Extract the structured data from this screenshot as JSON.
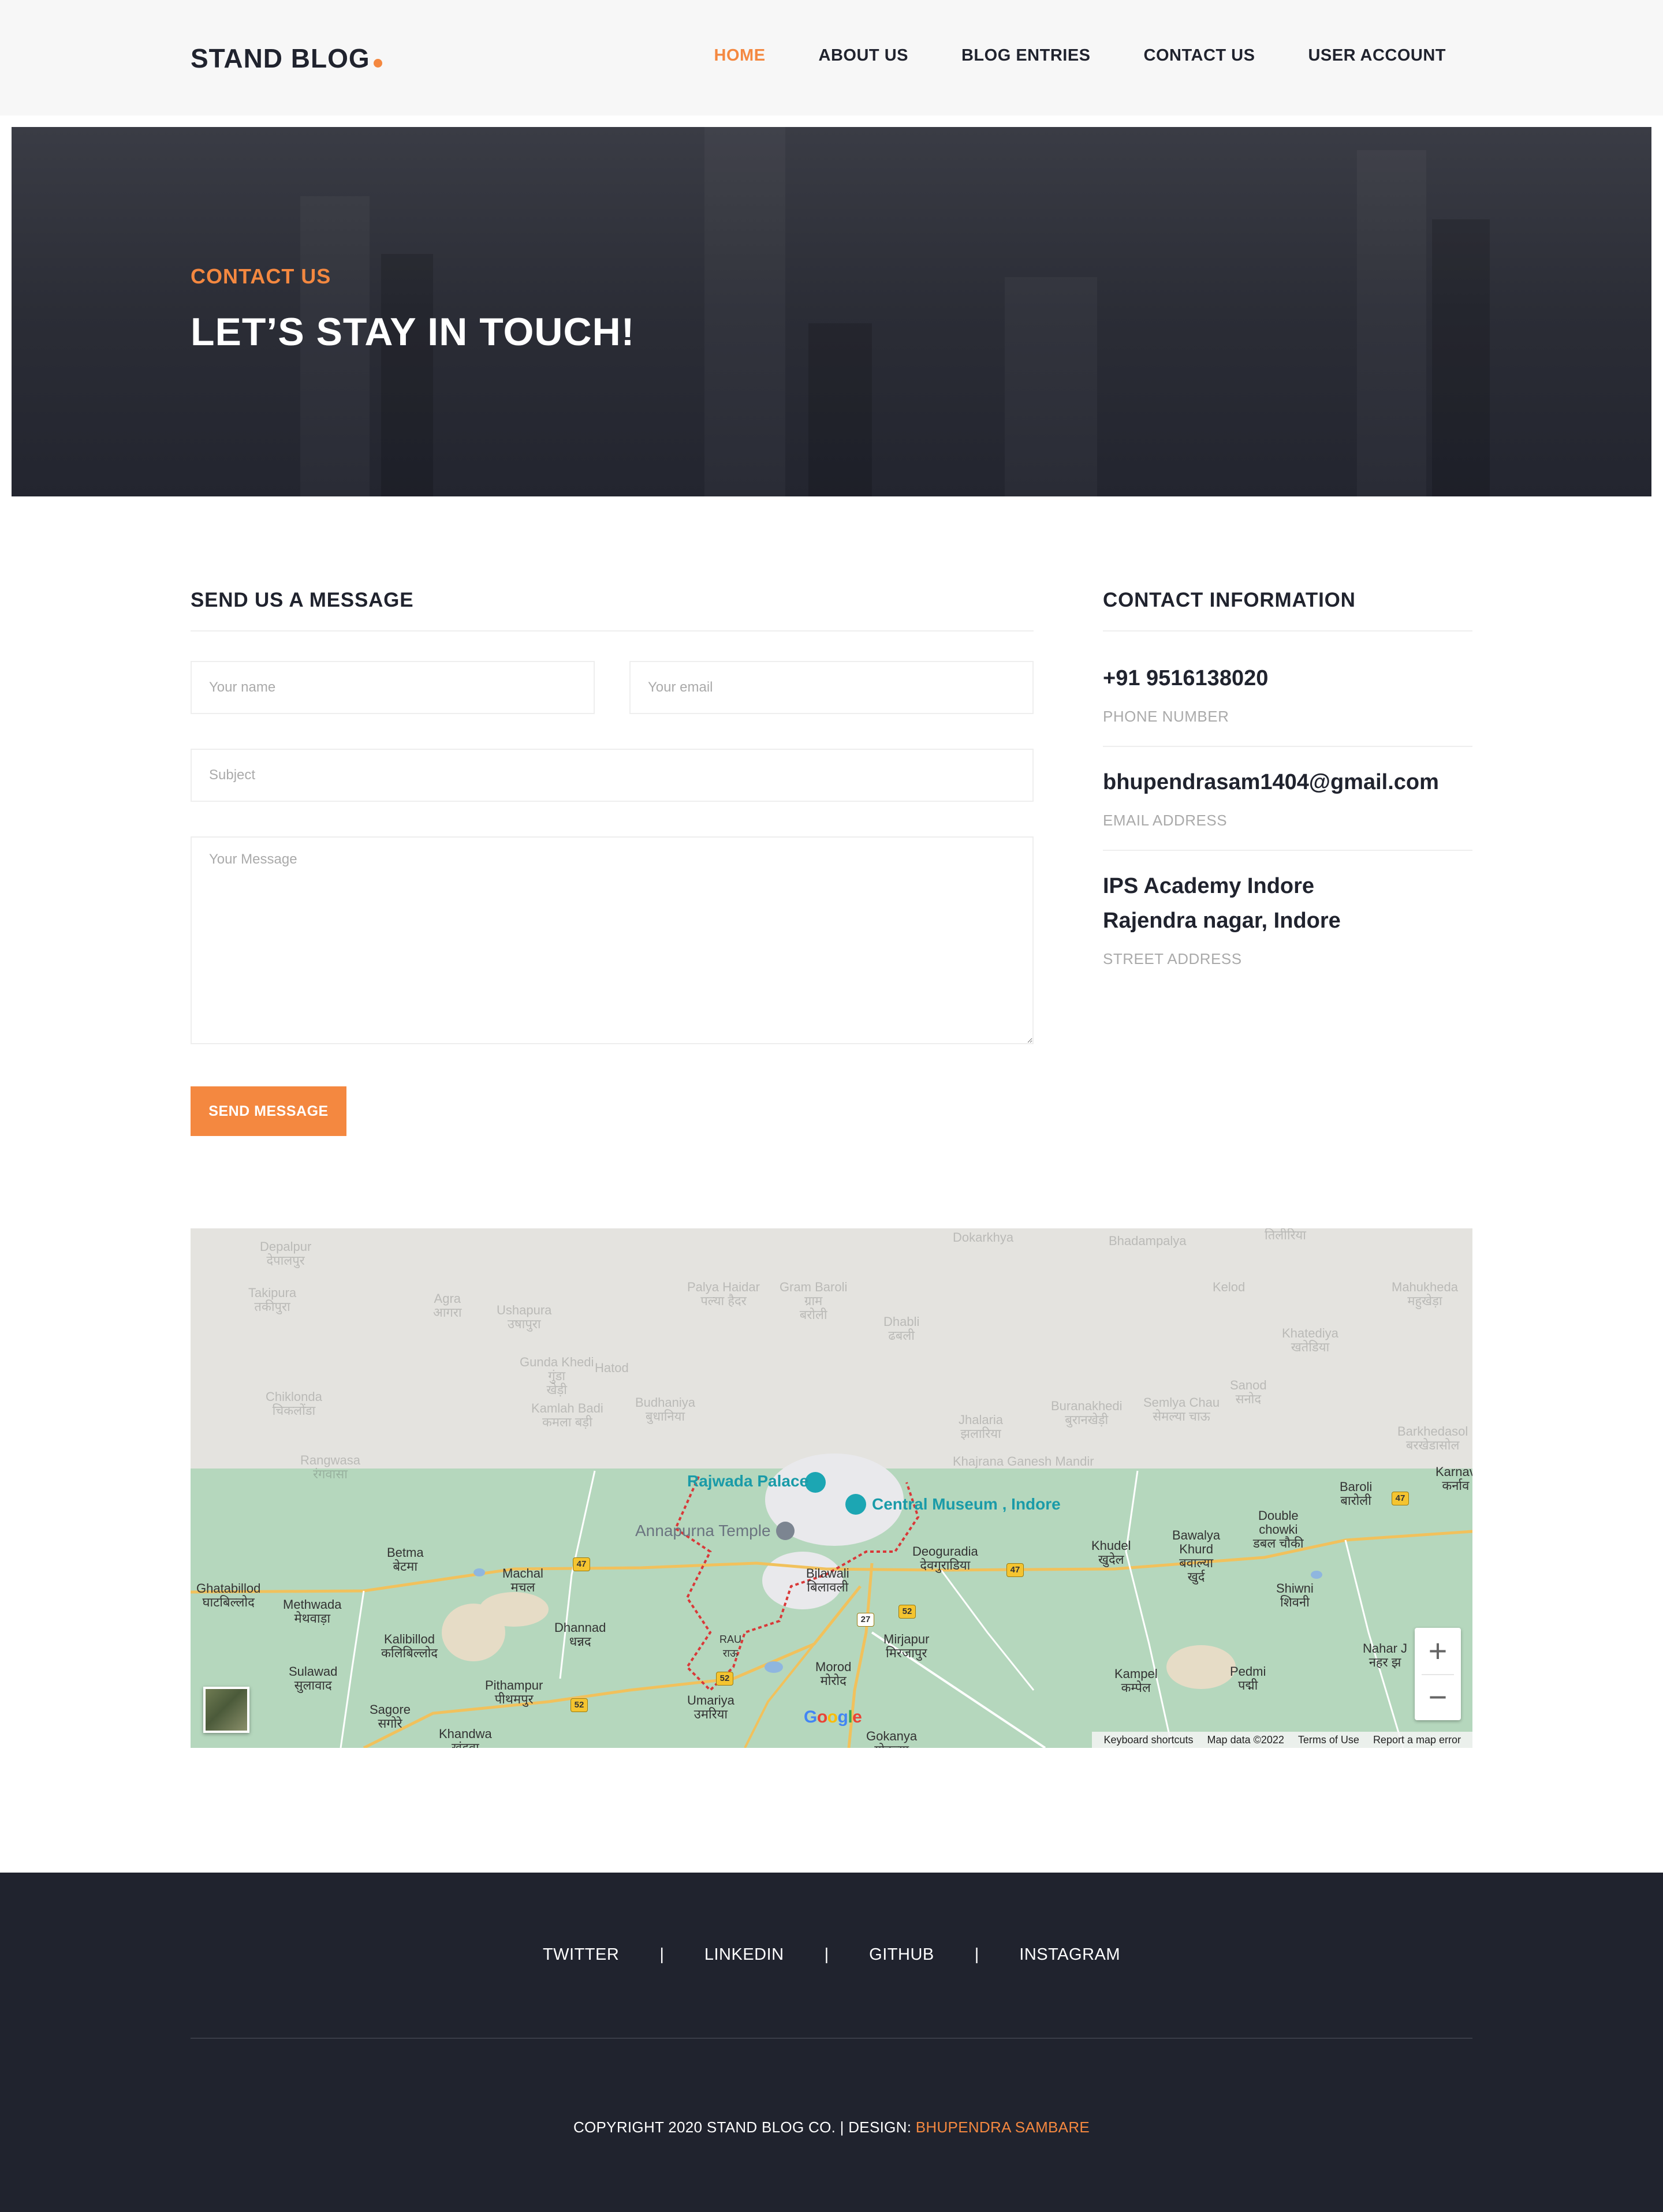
{
  "header": {
    "logo": "STAND BLOG",
    "nav": [
      "HOME",
      "ABOUT US",
      "BLOG ENTRIES",
      "CONTACT US",
      "USER ACCOUNT"
    ],
    "active_index": 0
  },
  "hero": {
    "kicker": "CONTACT US",
    "title": "LET’S STAY IN TOUCH!"
  },
  "form": {
    "title": "SEND US A MESSAGE",
    "name_placeholder": "Your name",
    "email_placeholder": "Your email",
    "subject_placeholder": "Subject",
    "message_placeholder": "Your Message",
    "submit_label": "SEND MESSAGE"
  },
  "contact_info": {
    "title": "CONTACT INFORMATION",
    "phone": "+91 9516138020",
    "phone_label": "PHONE NUMBER",
    "email": "bhupendrasam1404@gmail.com",
    "email_label": "EMAIL ADDRESS",
    "address_line1": "IPS Academy Indore",
    "address_line2": "Rajendra nagar, Indore",
    "address_label": "STREET ADDRESS"
  },
  "map": {
    "poi": {
      "rajwada": "Rajwada Palace",
      "central_museum": "Central Museum , Indore",
      "annapurna": "Annapurna Temple"
    },
    "places": {
      "betma": "Betma\nबेटमा",
      "machal": "Machal\nमचल",
      "ghatabillod": "Ghatabillod\nघाटबिल्लोद",
      "methwada": "Methwada\nमेथवाड़ा",
      "kalibillod": "Kalibillod\nकलिबिल्लोद",
      "dhannad": "Dhannad\nधन्नद",
      "sulawad": "Sulawad\nसुलावाद",
      "sagore": "Sagore\nसगोरे",
      "pithampur": "Pithampur\nपीथमपुर",
      "khandwa": "Khandwa\nखंडवा",
      "umariya": "Umariya\nउमरिया",
      "morod": "Morod\nमोरोद",
      "bilawali": "Bilawali\nबिलावली",
      "mirjapur": "Mirjapur\nमिरजापुर",
      "deoguradia": "Deoguradia\nदेवगुराडिया",
      "gokanya": "Gokanya\nगोकन्या",
      "khudel": "Khudel\nखुदेल",
      "bawalya": "Bawalya\nKhurd\nबवाल्या\nखुर्द",
      "double_chowki": "Double\nchowki\nडबल चौकी",
      "baroli": "Baroli\nबारोली",
      "shiwni": "Shiwni\nशिवनी",
      "kampel": "Kampel\nकम्पेल",
      "pedmi": "Pedmi\nपद्मी",
      "nahar": "Nahar J\nनहर झ",
      "karnav": "Karnav\nकर्नाव",
      "rau": "RAU\nराऊ"
    },
    "faint_places": {
      "depalpur": "Depalpur\nदेपालपुर",
      "takipura": "Takipura\nतकीपुरा",
      "agra": "Agra\nआगरा",
      "ushapura": "Ushapura\nउषापुरा",
      "palya_haidar": "Palya Haidar\nपल्या हैदर",
      "gram_baroli": "Gram Baroli\nग्राम\nबरोली",
      "dokarkhya": "Dokarkhya",
      "bhadampalya": "Bhadampalya",
      "tilirya": "तिलीरिया",
      "mahukheda": "Mahukheda\nमहुखेड़ा",
      "khatediya": "Khatediya\nखतेडिया",
      "kelod": "Kelod",
      "sanod": "Sanod\nसनोद",
      "gunda_khedi": "Gunda Khedi\nगुंडा\nखेड़ी",
      "hatod": "Hatod",
      "chiklonda": "Chiklonda\nचिकलोंडा",
      "kamlah": "Kamlah Badi\nकमला बड़ी",
      "budhaniya": "Budhaniya\nबुधानिया",
      "jhalaria": "Jhalaria\nझलारिया",
      "buranakhedi": "Buranakhedi\nबुरानखेड़ी",
      "semlya": "Semlya Chau\nसेमल्या चाऊ",
      "barkhedasol": "Barkhedasol\nबरखेडासोल",
      "rangwasa": "Rangwasa\nरंगवासा",
      "khajrana": "Khajrana Ganesh Mandir",
      "dhabli": "Dhabli\nढबली"
    },
    "routes": [
      "47",
      "47",
      "47",
      "52",
      "52",
      "52",
      "27"
    ],
    "google": "Google",
    "attribution": [
      "Keyboard shortcuts",
      "Map data ©2022",
      "Terms of Use",
      "Report a map error"
    ],
    "zoom_in": "+",
    "zoom_out": "−"
  },
  "footer": {
    "social": [
      "TWITTER",
      "LINKEDIN",
      "GITHUB",
      "INSTAGRAM"
    ],
    "separator": "|",
    "copyright": "COPYRIGHT 2020 STAND BLOG CO. | DESIGN: ",
    "designer": "BHUPENDRA SAMBARE"
  },
  "colors": {
    "accent": "#f48840",
    "dark": "#20232e",
    "muted": "#aaaaaa",
    "map_green": "#b5d7bd",
    "poi_teal": "#1a9ba8"
  }
}
